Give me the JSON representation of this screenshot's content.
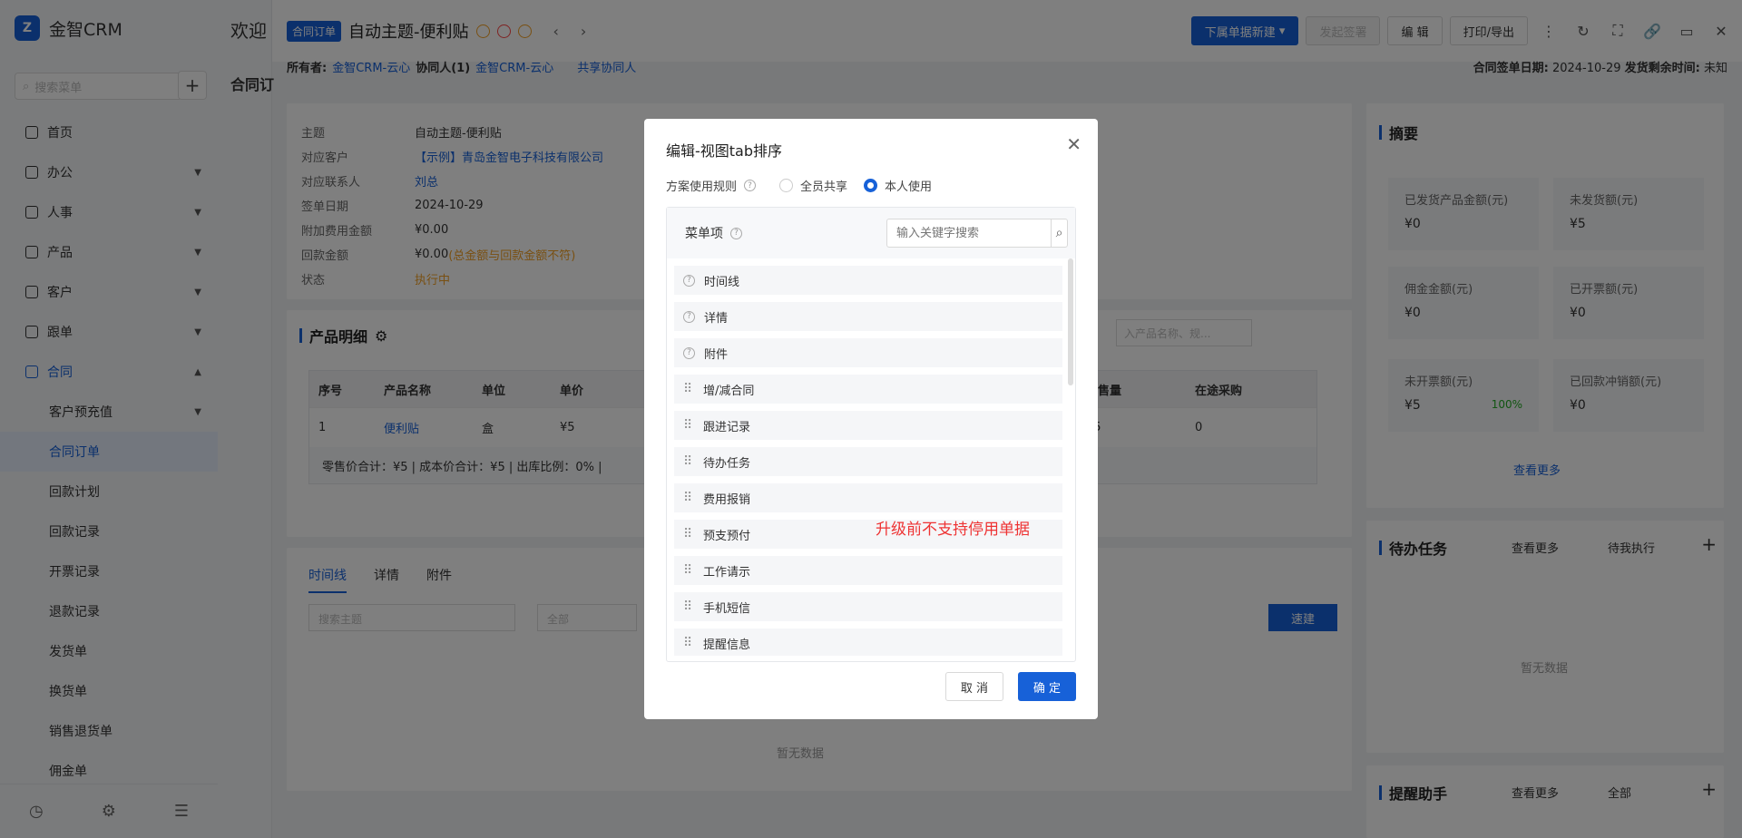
{
  "brand": {
    "name": "金智CRM",
    "logo": "Z"
  },
  "sidebar": {
    "search_placeholder": "搜索菜单",
    "items": [
      {
        "label": "首页"
      },
      {
        "label": "办公"
      },
      {
        "label": "人事"
      },
      {
        "label": "产品"
      },
      {
        "label": "客户"
      },
      {
        "label": "跟单"
      },
      {
        "label": "合同"
      }
    ],
    "sub_items": [
      {
        "label": "客户预充值"
      },
      {
        "label": "合同订单"
      },
      {
        "label": "回款计划"
      },
      {
        "label": "回款记录"
      },
      {
        "label": "开票记录"
      },
      {
        "label": "退款记录"
      },
      {
        "label": "发货单"
      },
      {
        "label": "换货单"
      },
      {
        "label": "销售退货单"
      },
      {
        "label": "佣金单"
      }
    ],
    "welcome": "欢迎",
    "tab_partial": "合同订"
  },
  "header": {
    "tag": "合同订单",
    "title": "自动主题-便利贴",
    "buttons": {
      "new": "下属单据新建",
      "sign": "发起签署",
      "edit": "编 辑",
      "print": "打印/导出"
    }
  },
  "subbar": {
    "owner_label": "所有者:",
    "owner": "金智CRM-云心",
    "collab_label": "协同人(1)",
    "collab": "金智CRM-云心",
    "share": "共享协同人",
    "sign_date_label": "合同签单日期:",
    "sign_date": "2024-10-29",
    "remaining_label": "发货剩余时间:",
    "remaining": "未知"
  },
  "info": {
    "rows": [
      {
        "k": "主题",
        "v": "自动主题-便利贴"
      },
      {
        "k": "对应客户",
        "v": "【示例】青岛金智电子科技有限公司"
      },
      {
        "k": "对应联系人",
        "v": "刘总"
      },
      {
        "k": "签单日期",
        "v": "2024-10-29"
      },
      {
        "k": "附加费用金额",
        "v": "¥0.00"
      },
      {
        "k": "回款金额",
        "v": "¥0.00"
      },
      {
        "k": "状态",
        "v": "执行中"
      }
    ],
    "refund_note": "(总金额与回款金额不符)"
  },
  "products": {
    "title": "产品明细",
    "search_placeholder": "入产品名称、规...",
    "headers": [
      "序号",
      "产品名称",
      "单位",
      "单价",
      "可售量",
      "在途采购"
    ],
    "row": [
      "1",
      "便利贴",
      "盒",
      "¥5",
      "85",
      "0"
    ],
    "footer": "零售价合计：¥5 |   成本价合计：¥5 |   出库比例：0% |"
  },
  "tabs": {
    "items": [
      "时间线",
      "详情",
      "附件"
    ],
    "search_placeholder": "搜索主题",
    "all": "全部",
    "quick": "速建",
    "empty": "暂无数据"
  },
  "summary": {
    "title": "摘要",
    "boxes": [
      {
        "label": "已发货产品金额(元)",
        "value": "¥0"
      },
      {
        "label": "未发货额(元)",
        "value": "¥5"
      },
      {
        "label": "佣金金额(元)",
        "value": "¥0"
      },
      {
        "label": "已开票额(元)",
        "value": "¥0"
      },
      {
        "label": "未开票额(元)",
        "value": "¥5",
        "pct": "100%"
      },
      {
        "label": "已回款冲销额(元)",
        "value": "¥0"
      }
    ],
    "more": "查看更多"
  },
  "todo": {
    "title": "待办任务",
    "more": "查看更多",
    "filter": "待我执行",
    "empty": "暂无数据"
  },
  "reminder": {
    "title": "提醒助手",
    "more": "查看更多",
    "filter": "全部"
  },
  "modal": {
    "title": "编辑-视图tab排序",
    "rule_label": "方案使用规则",
    "opt_all": "全员共享",
    "opt_self": "本人使用",
    "menu_label": "菜单项",
    "search_placeholder": "输入关键字搜索",
    "items": [
      "时间线",
      "详情",
      "附件",
      "增/减合同",
      "跟进记录",
      "待办任务",
      "费用报销",
      "预支预付",
      "工作请示",
      "手机短信",
      "提醒信息"
    ],
    "warning": "升级前不支持停用单据",
    "cancel": "取 消",
    "ok": "确 定"
  }
}
